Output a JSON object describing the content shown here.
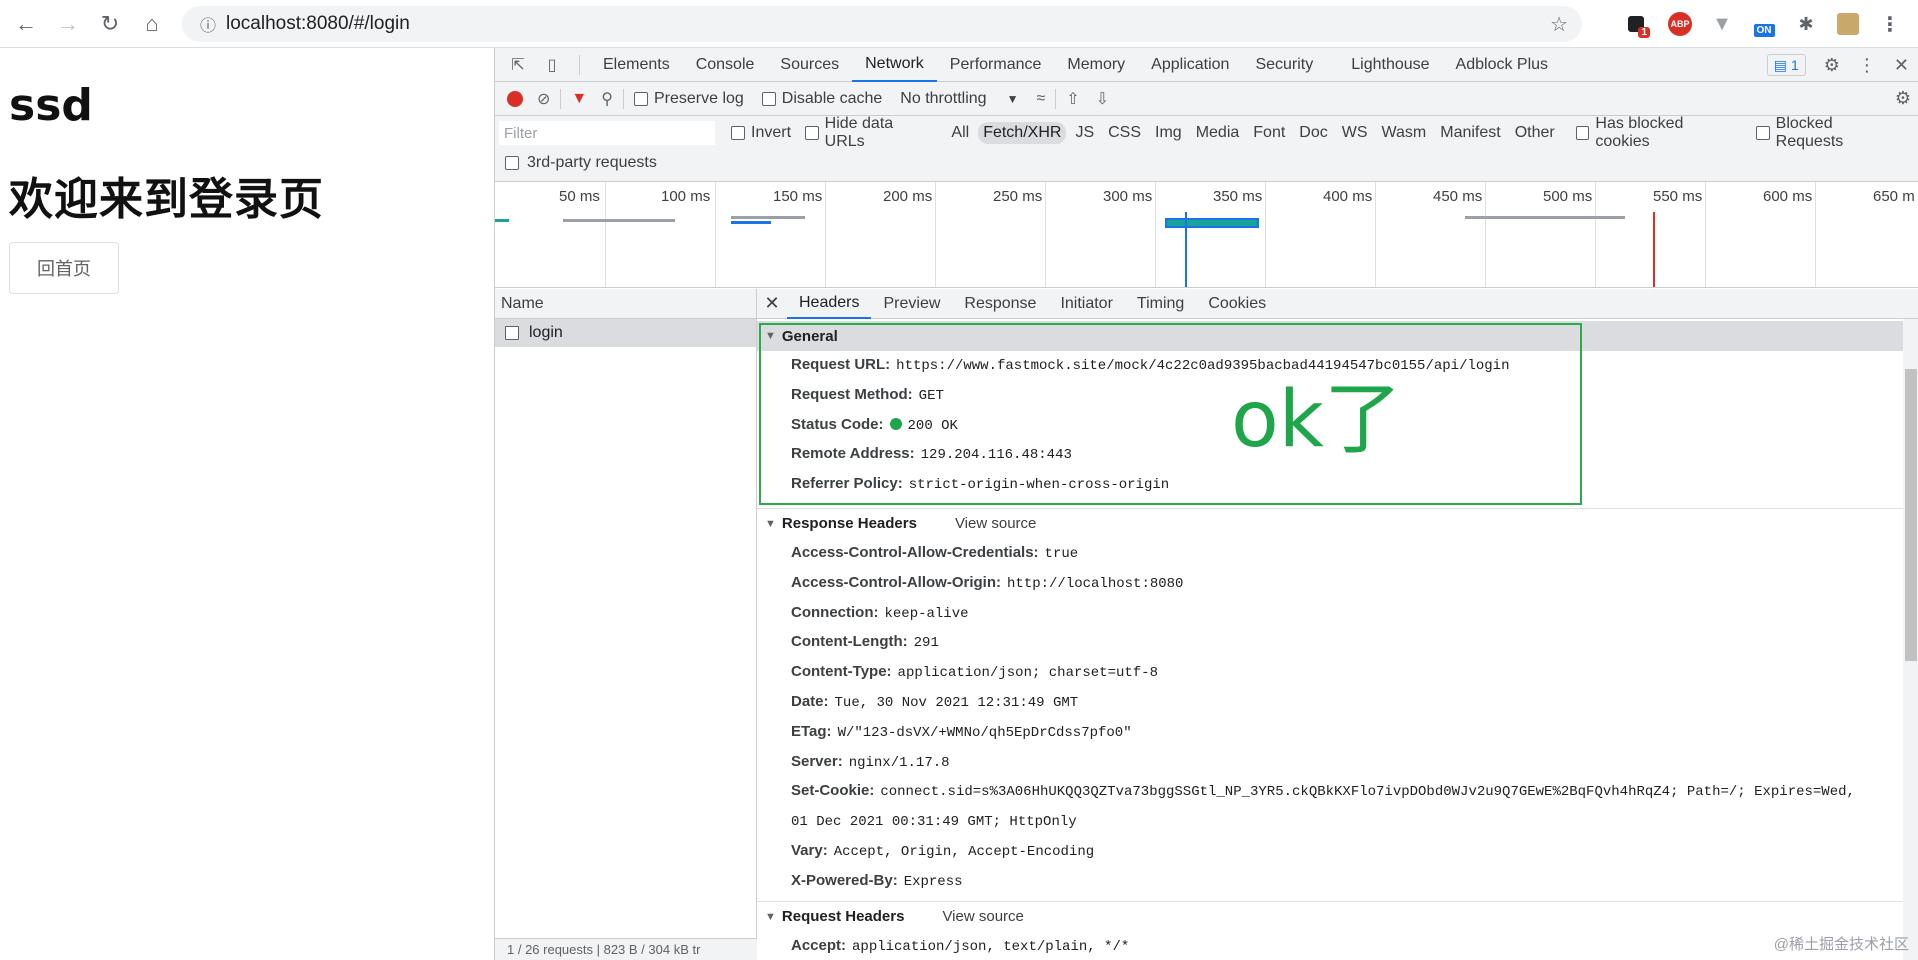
{
  "browser": {
    "url": "localhost:8080/#/login",
    "ext_badge": "1",
    "ext_abp": "ABP",
    "ext_on": "ON"
  },
  "page": {
    "title": "ssd",
    "subtitle": "欢迎来到登录页",
    "home_button": "回首页"
  },
  "devtools": {
    "tabs": [
      "Elements",
      "Console",
      "Sources",
      "Network",
      "Performance",
      "Memory",
      "Application",
      "Security",
      "Lighthouse",
      "Adblock Plus"
    ],
    "active_tab": "Network",
    "issues_count": "1",
    "toolbar": {
      "preserve_log": "Preserve log",
      "disable_cache": "Disable cache",
      "throttling": "No throttling"
    },
    "filter": {
      "placeholder": "Filter",
      "invert": "Invert",
      "hide_data_urls": "Hide data URLs",
      "types": [
        "All",
        "Fetch/XHR",
        "JS",
        "CSS",
        "Img",
        "Media",
        "Font",
        "Doc",
        "WS",
        "Wasm",
        "Manifest",
        "Other"
      ],
      "selected_type": "Fetch/XHR",
      "has_blocked_cookies": "Has blocked cookies",
      "blocked_requests": "Blocked Requests",
      "third_party": "3rd-party requests"
    },
    "timeline_ticks": [
      "50 ms",
      "100 ms",
      "150 ms",
      "200 ms",
      "250 ms",
      "300 ms",
      "350 ms",
      "400 ms",
      "450 ms",
      "500 ms",
      "550 ms",
      "600 ms",
      "650 m"
    ],
    "name_panel": {
      "header": "Name",
      "rows": [
        "login"
      ],
      "status": "1 / 26 requests  |  823 B / 304 kB tr"
    },
    "detail_tabs": [
      "Headers",
      "Preview",
      "Response",
      "Initiator",
      "Timing",
      "Cookies"
    ],
    "active_detail_tab": "Headers",
    "general": {
      "title": "General",
      "rows": [
        {
          "k": "Request URL:",
          "v": "https://www.fastmock.site/mock/4c22c0ad9395bacbad44194547bc0155/api/login"
        },
        {
          "k": "Request Method:",
          "v": "GET"
        },
        {
          "k": "Status Code:",
          "v": "200 OK"
        },
        {
          "k": "Remote Address:",
          "v": "129.204.116.48:443"
        },
        {
          "k": "Referrer Policy:",
          "v": "strict-origin-when-cross-origin"
        }
      ]
    },
    "annotation": "ok了",
    "response_headers": {
      "title": "Response Headers",
      "view_source": "View source",
      "rows": [
        {
          "k": "Access-Control-Allow-Credentials:",
          "v": "true"
        },
        {
          "k": "Access-Control-Allow-Origin:",
          "v": "http://localhost:8080"
        },
        {
          "k": "Connection:",
          "v": "keep-alive"
        },
        {
          "k": "Content-Length:",
          "v": "291"
        },
        {
          "k": "Content-Type:",
          "v": "application/json; charset=utf-8"
        },
        {
          "k": "Date:",
          "v": "Tue, 30 Nov 2021 12:31:49 GMT"
        },
        {
          "k": "ETag:",
          "v": "W/\"123-dsVX/+WMNo/qh5EpDrCdss7pfo0\""
        },
        {
          "k": "Server:",
          "v": "nginx/1.17.8"
        },
        {
          "k": "Set-Cookie:",
          "v": "connect.sid=s%3A06HhUKQQ3QZTva73bggSSGtl_NP_3YR5.ckQBkKXFlo7ivpDObd0WJv2u9Q7GEwE%2BqFQvh4hRqZ4; Path=/; Expires=Wed,"
        },
        {
          "k": "",
          "v": "01 Dec 2021 00:31:49 GMT; HttpOnly"
        },
        {
          "k": "Vary:",
          "v": "Accept, Origin, Accept-Encoding"
        },
        {
          "k": "X-Powered-By:",
          "v": "Express"
        }
      ]
    },
    "request_headers": {
      "title": "Request Headers",
      "view_source": "View source",
      "rows": [
        {
          "k": "Accept:",
          "v": "application/json, text/plain, */*"
        }
      ]
    },
    "watermark": "@稀土掘金技术社区",
    "colors": {
      "accent": "#1a73e8",
      "annotation": "#1fa64a",
      "record": "#d93025"
    }
  }
}
